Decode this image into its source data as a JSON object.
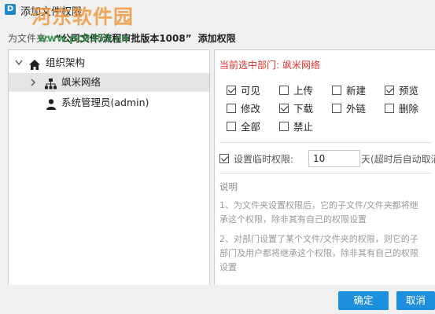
{
  "window": {
    "title": "添加文件权限",
    "icon_letter": "D"
  },
  "watermark": {
    "text": "河东软件园",
    "url": "www.pc0359.cn"
  },
  "target": {
    "label": "为文件夹:",
    "name": "“公司文件/流程审批版本1008”",
    "action": "添加权限"
  },
  "tree": [
    {
      "label": "组织架构",
      "icon": "home-icon"
    },
    {
      "label": "飒米网络",
      "icon": "org-icon",
      "selected": true
    },
    {
      "label": "系统管理员(admin)",
      "icon": "user-icon"
    }
  ],
  "current_dept": "当前选中部门: 飒米网络",
  "permissions": [
    {
      "label": "可见",
      "checked": true
    },
    {
      "label": "上传",
      "checked": false
    },
    {
      "label": "新建",
      "checked": false
    },
    {
      "label": "预览",
      "checked": true
    },
    {
      "label": "修改",
      "checked": false
    },
    {
      "label": "下载",
      "checked": true
    },
    {
      "label": "外链",
      "checked": false
    },
    {
      "label": "删除",
      "checked": false
    },
    {
      "label": "全部",
      "checked": false
    },
    {
      "label": "禁止",
      "checked": false
    }
  ],
  "temp_permission": {
    "checked": true,
    "label": "设置临时权限:",
    "days": "10",
    "suffix": "天(超时后自动取消"
  },
  "notes": {
    "title": "说明",
    "p1_line1": "1、为文件夹设置权限后，它的子文件/文件夹都将继",
    "p1_line2": "承这个权限，除非其有自己的权限设置",
    "p2_line1": "2、对部门设置了某个文件/文件夹的权限，则它的子",
    "p2_line2": "部门及用户都将继承这个权限，除非其有自己的权限",
    "p2_line3": "设置"
  },
  "buttons": {
    "confirm": "确定",
    "cancel": "取消"
  },
  "colors": {
    "accent": "#1e8fdc",
    "red_text": "#e0312b",
    "selected_row": "#e5e5e5"
  }
}
